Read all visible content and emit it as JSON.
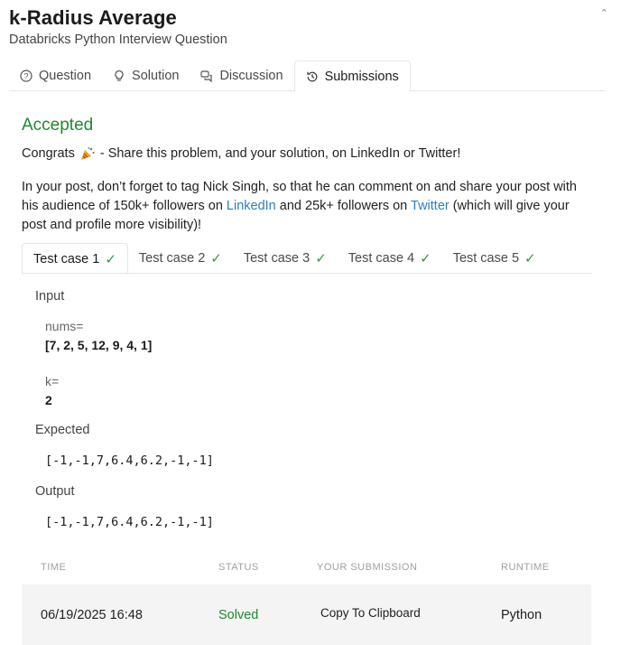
{
  "header": {
    "title": "k-Radius Average",
    "subtitle": "Databricks Python Interview Question"
  },
  "tabs": [
    {
      "label": "Question",
      "icon": "question-circle-icon"
    },
    {
      "label": "Solution",
      "icon": "lightbulb-icon"
    },
    {
      "label": "Discussion",
      "icon": "chat-bubbles-icon"
    },
    {
      "label": "Submissions",
      "icon": "history-icon"
    }
  ],
  "result": {
    "status": "Accepted",
    "congrats_prefix": "Congrats",
    "congrats_suffix": "- Share this problem, and your solution, on LinkedIn or Twitter!",
    "para_1": "In your post, don’t forget to tag Nick Singh, so that he can comment on and share your post with his audience of 150k+ followers on ",
    "linkedin": "LinkedIn",
    "para_2": " and 25k+ followers on ",
    "twitter": "Twitter",
    "para_3": " (which will give your post and profile more visibility)!"
  },
  "test_cases": [
    "Test case 1",
    "Test case 2",
    "Test case 3",
    "Test case 4",
    "Test case 5"
  ],
  "case": {
    "input_label": "Input",
    "var1_name": "nums=",
    "var1_value": "[7, 2, 5, 12, 9, 4, 1]",
    "var2_name": "k=",
    "var2_value": "2",
    "expected_label": "Expected",
    "expected_value": "[-1,-1,7,6.4,6.2,-1,-1]",
    "output_label": "Output",
    "output_value": "[-1,-1,7,6.4,6.2,-1,-1]"
  },
  "table": {
    "headers": [
      "TIME",
      "STATUS",
      "YOUR SUBMISSION",
      "RUNTIME"
    ],
    "row": {
      "time": "06/19/2025 16:48",
      "status": "Solved",
      "submission": "Copy To Clipboard",
      "runtime": "Python"
    }
  },
  "colors": {
    "accepted": "#1e8a2e",
    "link": "#2f7dc0",
    "check": "#2f9a45"
  }
}
